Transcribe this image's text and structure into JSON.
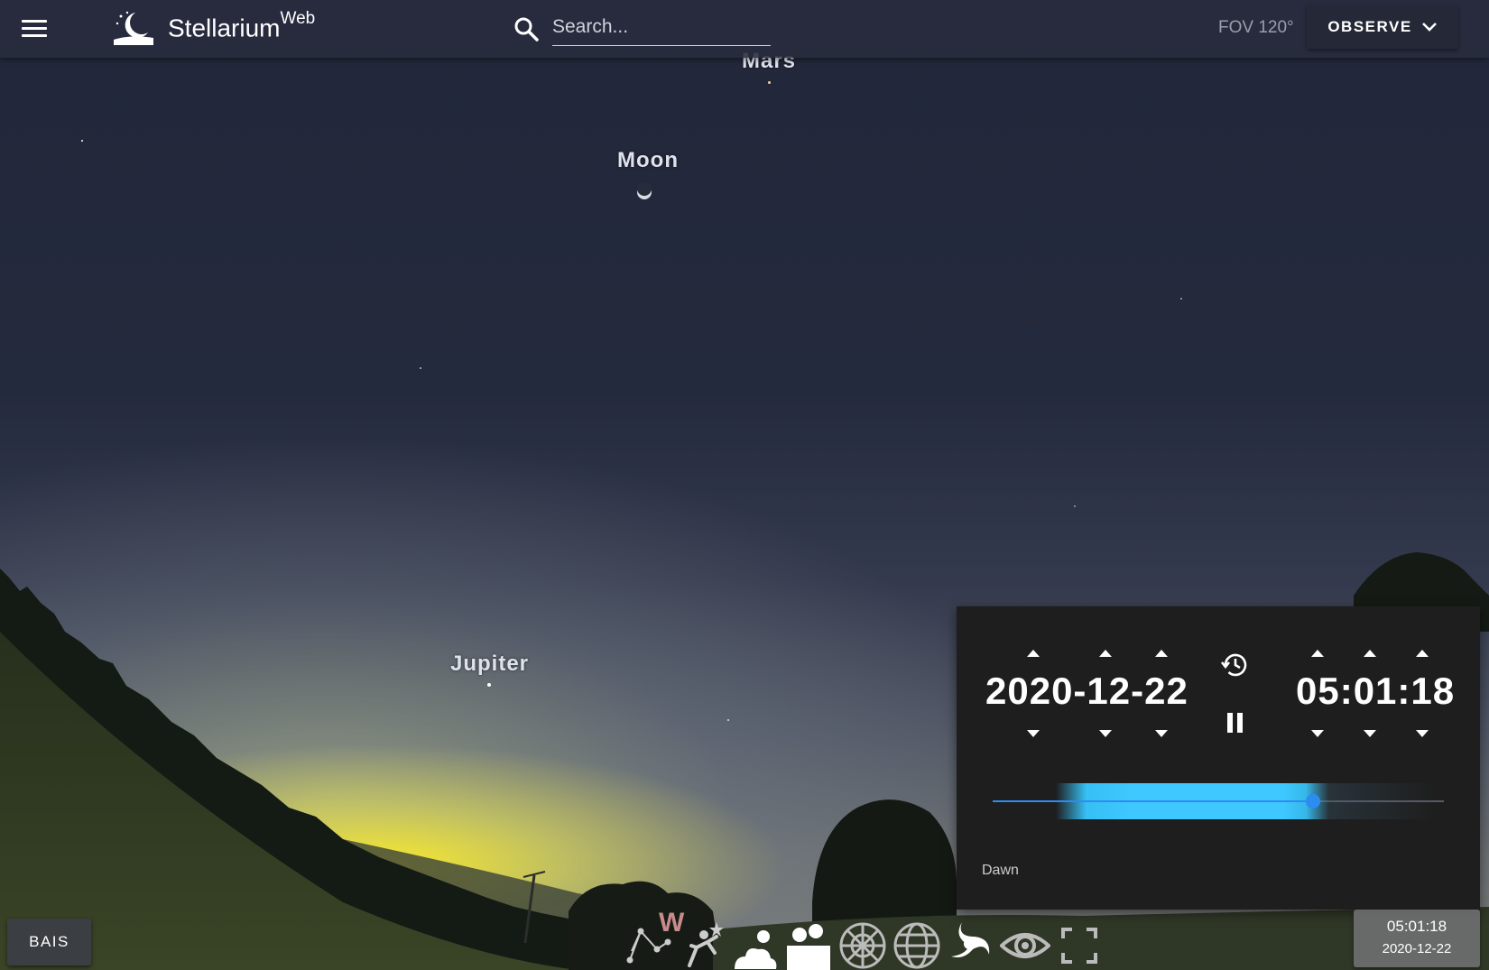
{
  "header": {
    "brand": "Stellarium",
    "brand_sup": "Web",
    "search_placeholder": "Search...",
    "fov": "FOV 120°",
    "observe_label": "OBSERVE"
  },
  "sky": {
    "labels": {
      "mars": "Mars",
      "moon": "Moon",
      "jupiter": "Jupiter"
    }
  },
  "time_panel": {
    "date": "2020-12-22",
    "time": "05:01:18",
    "period": "Dawn",
    "slider_fraction": 0.71,
    "slider_color": "#2d8cf0"
  },
  "bottom": {
    "location": "BAIS",
    "datetime_time": "05:01:18",
    "datetime_date": "2020-12-22"
  },
  "toolbar_icons": [
    "constellation-lines-icon",
    "cardinal-points-icon",
    "constellation-art-icon",
    "atmosphere-icon",
    "landscape-icon",
    "azimuthal-grid-icon",
    "equatorial-grid-icon",
    "deep-sky-objects-icon",
    "night-mode-icon",
    "fullscreen-icon"
  ]
}
